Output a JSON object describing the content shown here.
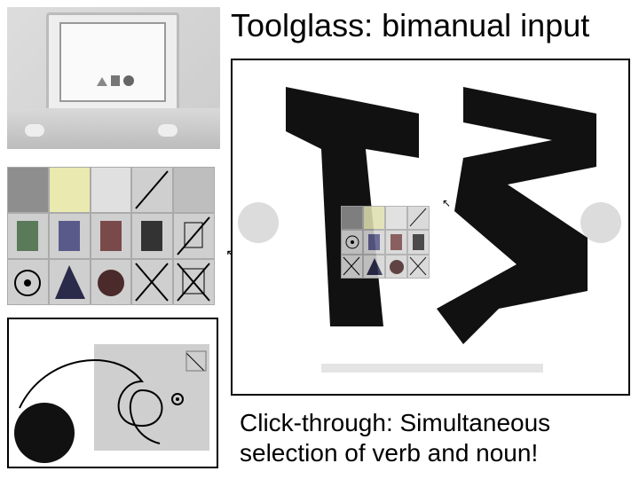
{
  "title": "Toolglass: bimanual input",
  "caption_line1": "Click-through: Simultaneous",
  "caption_line2": "selection of verb and noun!",
  "icons": {
    "cursor": "↖"
  }
}
